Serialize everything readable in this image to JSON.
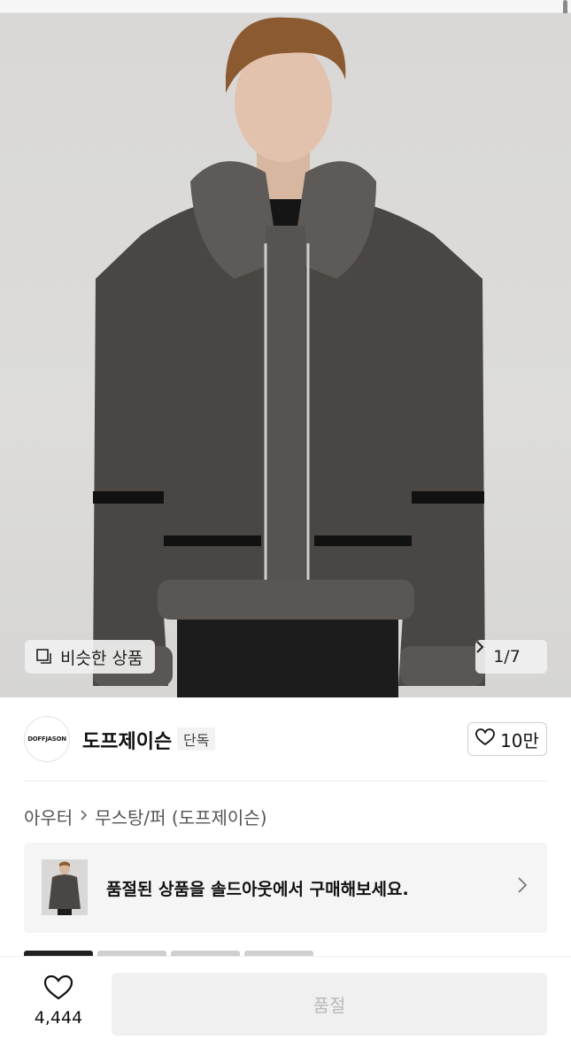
{
  "gallery": {
    "similar_label": "비슷한 상품",
    "counter": "1/7"
  },
  "brand": {
    "logo_text": "DOFFJASON",
    "name": "도프제이슨",
    "badge": "단독",
    "likes": "10만"
  },
  "breadcrumb": {
    "items": [
      "아우터",
      "무스탕/퍼 (도프제이슨)"
    ]
  },
  "soldout_banner": {
    "message": "품절된 상품을 솔드아웃에서 구매해보세요."
  },
  "bottom_bar": {
    "wish_count": "4,444",
    "button_label": "품절"
  }
}
